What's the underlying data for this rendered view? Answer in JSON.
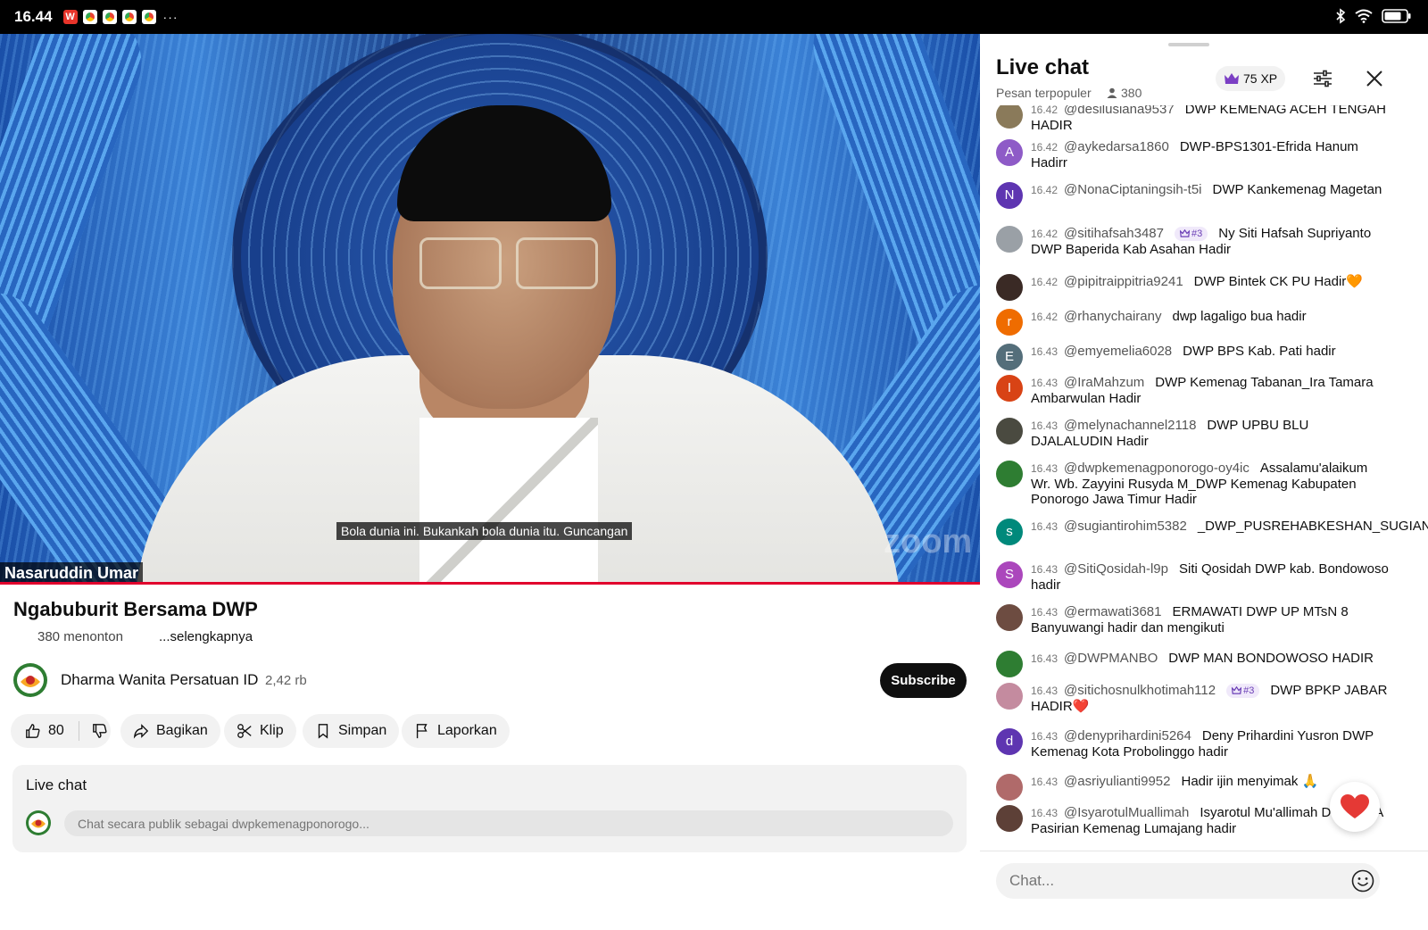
{
  "status_bar": {
    "time": "16.44",
    "overflow": "···"
  },
  "video": {
    "subtitle": "Bola dunia ini. Bukankah bola dunia itu. Guncangan",
    "speaker_name": "Nasaruddin Umar",
    "watermark": "zoom"
  },
  "stream": {
    "title": "Ngabuburit Bersama DWP",
    "viewers": "380 menonton",
    "more": "...selengkapnya"
  },
  "channel": {
    "name": "Dharma Wanita Persatuan ID",
    "subscribers": "2,42 rb",
    "subscribe_label": "Subscribe"
  },
  "actions": {
    "likes": "80",
    "share": "Bagikan",
    "clip": "Klip",
    "save": "Simpan",
    "report": "Laporkan"
  },
  "live_chat_box": {
    "label": "Live chat",
    "placeholder": "Chat secara publik sebagai dwpkemenagponorogo..."
  },
  "chat_panel": {
    "title": "Live chat",
    "mode": "Pesan terpopuler",
    "viewer_count": "380",
    "xp": "75 XP",
    "input_placeholder": "Chat...",
    "messages": [
      {
        "time": "16.42",
        "author": "@desilusiana9537",
        "text": "DWP KEMENAG ACEH TENGAH HADIR",
        "avatar": "",
        "avatar_color": "#8a7a5a"
      },
      {
        "time": "16.42",
        "author": "@aykedarsa1860",
        "text": "DWP-BPS1301-Efrida Hanum Hadirr",
        "avatar": "A",
        "avatar_color": "#8e5bc7"
      },
      {
        "time": "16.42",
        "author": "@NonaCiptaningsih-t5i",
        "text": "DWP Kankemenag Magetan",
        "avatar": "N",
        "avatar_color": "#5e35b1"
      },
      {
        "time": "16.42",
        "author": "@sitihafsah3487",
        "badge": "#3",
        "text": "Ny Siti Hafsah Supriyanto DWP Baperida Kab Asahan Hadir",
        "avatar": "",
        "avatar_color": "#9aa0a6"
      },
      {
        "time": "16.42",
        "author": "@pipitraippitria9241",
        "text": "DWP Bintek CK PU Hadir🧡",
        "avatar": "",
        "avatar_color": "#3a2a25"
      },
      {
        "time": "16.42",
        "author": "@rhanychairany",
        "text": "dwp lagaligo bua hadir",
        "avatar": "r",
        "avatar_color": "#ef6c00"
      },
      {
        "time": "16.43",
        "author": "@emyemelia6028",
        "text": "DWP BPS Kab. Pati hadir",
        "avatar": "E",
        "avatar_color": "#546e7a"
      },
      {
        "time": "16.43",
        "author": "@IraMahzum",
        "text": "DWP Kemenag Tabanan_Ira Tamara Ambarwulan Hadir",
        "avatar": "I",
        "avatar_color": "#d84315"
      },
      {
        "time": "16.43",
        "author": "@melynachannel2118",
        "text": "DWP UPBU BLU DJALALUDIN Hadir",
        "avatar": "",
        "avatar_color": "#4a4a40"
      },
      {
        "time": "16.43",
        "author": "@dwpkemenagponorogo-oy4ic",
        "text": "Assalamu'alaikum Wr. Wb. Zayyini Rusyda M_DWP Kemenag Kabupaten Ponorogo Jawa Timur Hadir",
        "avatar": "",
        "avatar_color": "#2e7d32"
      },
      {
        "time": "16.43",
        "author": "@sugiantirohim5382",
        "text": "_DWP_PUSREHABKESHAN_SUGIANTIRAHIM",
        "avatar": "s",
        "avatar_color": "#00897b"
      },
      {
        "time": "16.43",
        "author": "@SitiQosidah-l9p",
        "text": "Siti Qosidah DWP kab. Bondowoso hadir",
        "avatar": "S",
        "avatar_color": "#ab47bc"
      },
      {
        "time": "16.43",
        "author": "@ermawati3681",
        "text": "ERMAWATI DWP UP MTsN 8 Banyuwangi hadir dan mengikuti",
        "avatar": "",
        "avatar_color": "#6d4c41"
      },
      {
        "time": "16.43",
        "author": "@DWPMANBO",
        "text": "DWP MAN BONDOWOSO HADIR",
        "avatar": "",
        "avatar_color": "#2e7d32"
      },
      {
        "time": "16.43",
        "author": "@sitichosnulkhotimah112",
        "badge": "#3",
        "text": "DWP BPKP JABAR HADIR❤️",
        "avatar": "",
        "avatar_color": "#c48b9f"
      },
      {
        "time": "16.43",
        "author": "@denyprihardini5264",
        "text": "Deny Prihardini Yusron DWP Kemenag Kota Probolinggo hadir",
        "avatar": "d",
        "avatar_color": "#5e35b1"
      },
      {
        "time": "16.43",
        "author": "@asriyulianti9952",
        "text": "Hadir ijin menyimak 🙏",
        "avatar": "",
        "avatar_color": "#b06a6a"
      },
      {
        "time": "16.43",
        "author": "@IsyarotulMuallimah",
        "text": "Isyarotul Mu'allimah DWP KUA Pasirian Kemenag Lumajang hadir",
        "avatar": "",
        "avatar_color": "#5d4037"
      }
    ]
  },
  "colors": {
    "accent_red": "#e1002d",
    "xp_purple": "#6b3fb6"
  }
}
